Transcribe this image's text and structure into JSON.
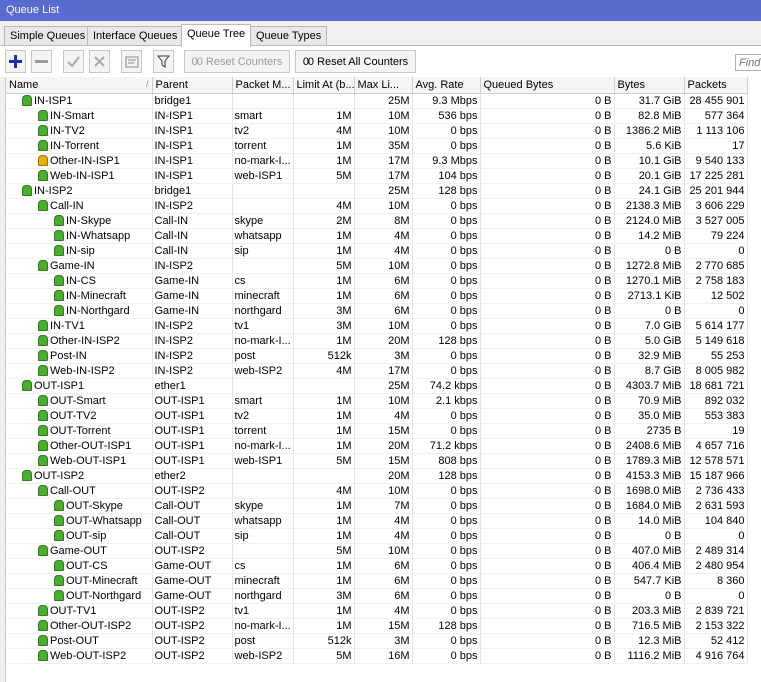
{
  "window": {
    "title": "Queue List"
  },
  "tabs": [
    "Simple Queues",
    "Interface Queues",
    "Queue Tree",
    "Queue Types"
  ],
  "active_tab": "Queue Tree",
  "toolbar": {
    "add_icon": "plus-icon",
    "remove_icon": "minus-icon",
    "enable_icon": "check-icon",
    "disable_icon": "x-icon",
    "comment_icon": "comment-icon",
    "filter_icon": "filter-icon",
    "reset_counters": "Reset Counters",
    "reset_all_counters": "Reset All Counters",
    "counter_glyph": "00",
    "find_placeholder": "Find"
  },
  "columns": [
    "Name",
    "Parent",
    "Packet M...",
    "Limit At (b...",
    "Max Li...",
    "Avg. Rate",
    "Queued Bytes",
    "Bytes",
    "Packets"
  ],
  "rows": [
    {
      "depth": 0,
      "status": "ok",
      "name": "IN-ISP1",
      "parent": "bridge1",
      "mark": "",
      "limit": "",
      "max": "25M",
      "avg": "9.3 Mbps",
      "queued": "0 B",
      "bytes": "31.7 GiB",
      "packets": "28 455 901"
    },
    {
      "depth": 1,
      "status": "ok",
      "name": "IN-Smart",
      "parent": "IN-ISP1",
      "mark": "smart",
      "limit": "1M",
      "max": "10M",
      "avg": "536 bps",
      "queued": "0 B",
      "bytes": "82.8 MiB",
      "packets": "577 364"
    },
    {
      "depth": 1,
      "status": "ok",
      "name": "IN-TV2",
      "parent": "IN-ISP1",
      "mark": "tv2",
      "limit": "4M",
      "max": "10M",
      "avg": "0 bps",
      "queued": "0 B",
      "bytes": "1386.2 MiB",
      "packets": "1 113 106"
    },
    {
      "depth": 1,
      "status": "ok",
      "name": "IN-Torrent",
      "parent": "IN-ISP1",
      "mark": "torrent",
      "limit": "1M",
      "max": "35M",
      "avg": "0 bps",
      "queued": "0 B",
      "bytes": "5.6 KiB",
      "packets": "17"
    },
    {
      "depth": 1,
      "status": "warn",
      "name": "Other-IN-ISP1",
      "parent": "IN-ISP1",
      "mark": "no-mark-I...",
      "limit": "1M",
      "max": "17M",
      "avg": "9.3 Mbps",
      "queued": "0 B",
      "bytes": "10.1 GiB",
      "packets": "9 540 133"
    },
    {
      "depth": 1,
      "status": "ok",
      "name": "Web-IN-ISP1",
      "parent": "IN-ISP1",
      "mark": "web-ISP1",
      "limit": "5M",
      "max": "17M",
      "avg": "104 bps",
      "queued": "0 B",
      "bytes": "20.1 GiB",
      "packets": "17 225 281"
    },
    {
      "depth": 0,
      "status": "ok",
      "name": "IN-ISP2",
      "parent": "bridge1",
      "mark": "",
      "limit": "",
      "max": "25M",
      "avg": "128 bps",
      "queued": "0 B",
      "bytes": "24.1 GiB",
      "packets": "25 201 944"
    },
    {
      "depth": 1,
      "status": "ok",
      "name": "Call-IN",
      "parent": "IN-ISP2",
      "mark": "",
      "limit": "4M",
      "max": "10M",
      "avg": "0 bps",
      "queued": "0 B",
      "bytes": "2138.3 MiB",
      "packets": "3 606 229"
    },
    {
      "depth": 2,
      "status": "ok",
      "name": "IN-Skype",
      "parent": "Call-IN",
      "mark": "skype",
      "limit": "2M",
      "max": "8M",
      "avg": "0 bps",
      "queued": "0 B",
      "bytes": "2124.0 MiB",
      "packets": "3 527 005"
    },
    {
      "depth": 2,
      "status": "ok",
      "name": "IN-Whatsapp",
      "parent": "Call-IN",
      "mark": "whatsapp",
      "limit": "1M",
      "max": "4M",
      "avg": "0 bps",
      "queued": "0 B",
      "bytes": "14.2 MiB",
      "packets": "79 224"
    },
    {
      "depth": 2,
      "status": "ok",
      "name": "IN-sip",
      "parent": "Call-IN",
      "mark": "sip",
      "limit": "1M",
      "max": "4M",
      "avg": "0 bps",
      "queued": "0 B",
      "bytes": "0 B",
      "packets": "0"
    },
    {
      "depth": 1,
      "status": "ok",
      "name": "Game-IN",
      "parent": "IN-ISP2",
      "mark": "",
      "limit": "5M",
      "max": "10M",
      "avg": "0 bps",
      "queued": "0 B",
      "bytes": "1272.8 MiB",
      "packets": "2 770 685"
    },
    {
      "depth": 2,
      "status": "ok",
      "name": "IN-CS",
      "parent": "Game-IN",
      "mark": "cs",
      "limit": "1M",
      "max": "6M",
      "avg": "0 bps",
      "queued": "0 B",
      "bytes": "1270.1 MiB",
      "packets": "2 758 183"
    },
    {
      "depth": 2,
      "status": "ok",
      "name": "IN-Minecraft",
      "parent": "Game-IN",
      "mark": "minecraft",
      "limit": "1M",
      "max": "6M",
      "avg": "0 bps",
      "queued": "0 B",
      "bytes": "2713.1 KiB",
      "packets": "12 502"
    },
    {
      "depth": 2,
      "status": "ok",
      "name": "IN-Northgard",
      "parent": "Game-IN",
      "mark": "northgard",
      "limit": "3M",
      "max": "6M",
      "avg": "0 bps",
      "queued": "0 B",
      "bytes": "0 B",
      "packets": "0"
    },
    {
      "depth": 1,
      "status": "ok",
      "name": "IN-TV1",
      "parent": "IN-ISP2",
      "mark": "tv1",
      "limit": "3M",
      "max": "10M",
      "avg": "0 bps",
      "queued": "0 B",
      "bytes": "7.0 GiB",
      "packets": "5 614 177"
    },
    {
      "depth": 1,
      "status": "ok",
      "name": "Other-IN-ISP2",
      "parent": "IN-ISP2",
      "mark": "no-mark-I...",
      "limit": "1M",
      "max": "20M",
      "avg": "128 bps",
      "queued": "0 B",
      "bytes": "5.0 GiB",
      "packets": "5 149 618"
    },
    {
      "depth": 1,
      "status": "ok",
      "name": "Post-IN",
      "parent": "IN-ISP2",
      "mark": "post",
      "limit": "512k",
      "max": "3M",
      "avg": "0 bps",
      "queued": "0 B",
      "bytes": "32.9 MiB",
      "packets": "55 253"
    },
    {
      "depth": 1,
      "status": "ok",
      "name": "Web-IN-ISP2",
      "parent": "IN-ISP2",
      "mark": "web-ISP2",
      "limit": "4M",
      "max": "17M",
      "avg": "0 bps",
      "queued": "0 B",
      "bytes": "8.7 GiB",
      "packets": "8 005 982"
    },
    {
      "depth": 0,
      "status": "ok",
      "name": "OUT-ISP1",
      "parent": "ether1",
      "mark": "",
      "limit": "",
      "max": "25M",
      "avg": "74.2 kbps",
      "queued": "0 B",
      "bytes": "4303.7 MiB",
      "packets": "18 681 721"
    },
    {
      "depth": 1,
      "status": "ok",
      "name": "OUT-Smart",
      "parent": "OUT-ISP1",
      "mark": "smart",
      "limit": "1M",
      "max": "10M",
      "avg": "2.1 kbps",
      "queued": "0 B",
      "bytes": "70.9 MiB",
      "packets": "892 032"
    },
    {
      "depth": 1,
      "status": "ok",
      "name": "OUT-TV2",
      "parent": "OUT-ISP1",
      "mark": "tv2",
      "limit": "1M",
      "max": "4M",
      "avg": "0 bps",
      "queued": "0 B",
      "bytes": "35.0 MiB",
      "packets": "553 383"
    },
    {
      "depth": 1,
      "status": "ok",
      "name": "OUT-Torrent",
      "parent": "OUT-ISP1",
      "mark": "torrent",
      "limit": "1M",
      "max": "15M",
      "avg": "0 bps",
      "queued": "0 B",
      "bytes": "2735 B",
      "packets": "19"
    },
    {
      "depth": 1,
      "status": "ok",
      "name": "Other-OUT-ISP1",
      "parent": "OUT-ISP1",
      "mark": "no-mark-I...",
      "limit": "1M",
      "max": "20M",
      "avg": "71.2 kbps",
      "queued": "0 B",
      "bytes": "2408.6 MiB",
      "packets": "4 657 716"
    },
    {
      "depth": 1,
      "status": "ok",
      "name": "Web-OUT-ISP1",
      "parent": "OUT-ISP1",
      "mark": "web-ISP1",
      "limit": "5M",
      "max": "15M",
      "avg": "808 bps",
      "queued": "0 B",
      "bytes": "1789.3 MiB",
      "packets": "12 578 571"
    },
    {
      "depth": 0,
      "status": "ok",
      "name": "OUT-ISP2",
      "parent": "ether2",
      "mark": "",
      "limit": "",
      "max": "20M",
      "avg": "128 bps",
      "queued": "0 B",
      "bytes": "4153.3 MiB",
      "packets": "15 187 966"
    },
    {
      "depth": 1,
      "status": "ok",
      "name": "Call-OUT",
      "parent": "OUT-ISP2",
      "mark": "",
      "limit": "4M",
      "max": "10M",
      "avg": "0 bps",
      "queued": "0 B",
      "bytes": "1698.0 MiB",
      "packets": "2 736 433"
    },
    {
      "depth": 2,
      "status": "ok",
      "name": "OUT-Skype",
      "parent": "Call-OUT",
      "mark": "skype",
      "limit": "1M",
      "max": "7M",
      "avg": "0 bps",
      "queued": "0 B",
      "bytes": "1684.0 MiB",
      "packets": "2 631 593"
    },
    {
      "depth": 2,
      "status": "ok",
      "name": "OUT-Whatsapp",
      "parent": "Call-OUT",
      "mark": "whatsapp",
      "limit": "1M",
      "max": "4M",
      "avg": "0 bps",
      "queued": "0 B",
      "bytes": "14.0 MiB",
      "packets": "104 840"
    },
    {
      "depth": 2,
      "status": "ok",
      "name": "OUT-sip",
      "parent": "Call-OUT",
      "mark": "sip",
      "limit": "1M",
      "max": "4M",
      "avg": "0 bps",
      "queued": "0 B",
      "bytes": "0 B",
      "packets": "0"
    },
    {
      "depth": 1,
      "status": "ok",
      "name": "Game-OUT",
      "parent": "OUT-ISP2",
      "mark": "",
      "limit": "5M",
      "max": "10M",
      "avg": "0 bps",
      "queued": "0 B",
      "bytes": "407.0 MiB",
      "packets": "2 489 314"
    },
    {
      "depth": 2,
      "status": "ok",
      "name": "OUT-CS",
      "parent": "Game-OUT",
      "mark": "cs",
      "limit": "1M",
      "max": "6M",
      "avg": "0 bps",
      "queued": "0 B",
      "bytes": "406.4 MiB",
      "packets": "2 480 954"
    },
    {
      "depth": 2,
      "status": "ok",
      "name": "OUT-Minecraft",
      "parent": "Game-OUT",
      "mark": "minecraft",
      "limit": "1M",
      "max": "6M",
      "avg": "0 bps",
      "queued": "0 B",
      "bytes": "547.7 KiB",
      "packets": "8 360"
    },
    {
      "depth": 2,
      "status": "ok",
      "name": "OUT-Northgard",
      "parent": "Game-OUT",
      "mark": "northgard",
      "limit": "3M",
      "max": "6M",
      "avg": "0 bps",
      "queued": "0 B",
      "bytes": "0 B",
      "packets": "0"
    },
    {
      "depth": 1,
      "status": "ok",
      "name": "OUT-TV1",
      "parent": "OUT-ISP2",
      "mark": "tv1",
      "limit": "1M",
      "max": "4M",
      "avg": "0 bps",
      "queued": "0 B",
      "bytes": "203.3 MiB",
      "packets": "2 839 721"
    },
    {
      "depth": 1,
      "status": "ok",
      "name": "Other-OUT-ISP2",
      "parent": "OUT-ISP2",
      "mark": "no-mark-I...",
      "limit": "1M",
      "max": "15M",
      "avg": "128 bps",
      "queued": "0 B",
      "bytes": "716.5 MiB",
      "packets": "2 153 322"
    },
    {
      "depth": 1,
      "status": "ok",
      "name": "Post-OUT",
      "parent": "OUT-ISP2",
      "mark": "post",
      "limit": "512k",
      "max": "3M",
      "avg": "0 bps",
      "queued": "0 B",
      "bytes": "12.3 MiB",
      "packets": "52 412"
    },
    {
      "depth": 1,
      "status": "ok",
      "name": "Web-OUT-ISP2",
      "parent": "OUT-ISP2",
      "mark": "web-ISP2",
      "limit": "5M",
      "max": "16M",
      "avg": "0 bps",
      "queued": "0 B",
      "bytes": "1116.2 MiB",
      "packets": "4 916 764"
    }
  ]
}
